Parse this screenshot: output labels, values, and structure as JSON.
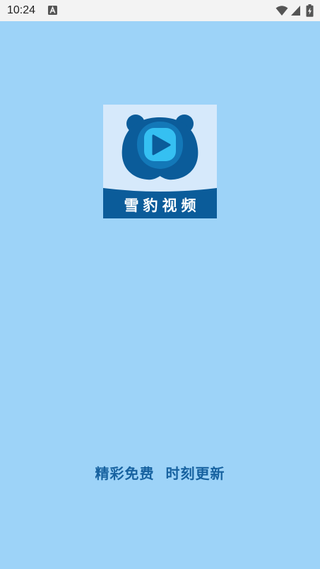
{
  "status_bar": {
    "time": "10:24",
    "icons": [
      "a-icon",
      "wifi-icon",
      "signal-icon",
      "battery-icon"
    ]
  },
  "splash": {
    "app_name": "雪豹视频",
    "slogan": "精彩免费  时刻更新"
  },
  "colors": {
    "background": "#9dd3f8",
    "logo_bg": "#d6e9fb",
    "logo_dark": "#0b5c9a",
    "logo_play": "#35c0f2",
    "slogan": "#1762a0"
  }
}
